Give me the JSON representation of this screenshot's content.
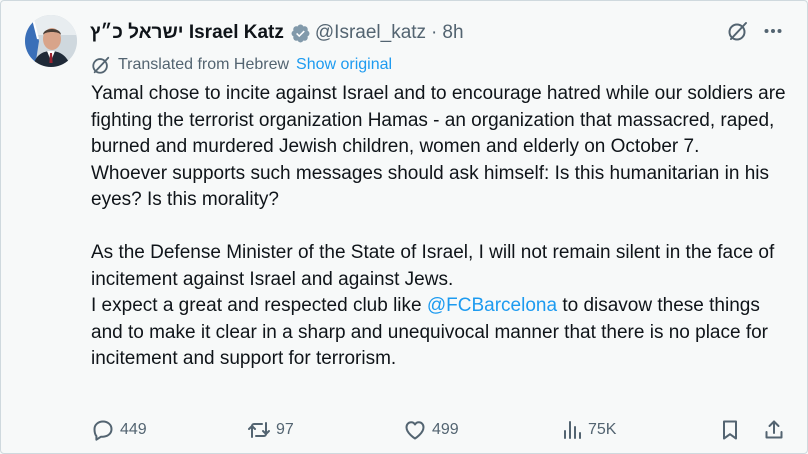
{
  "author": {
    "hebrew_name": "ישראל כ״ץ",
    "display_name": "Israel Katz",
    "handle": "@Israel_katz",
    "separator": "·",
    "time": "8h"
  },
  "translation": {
    "label": "Translated from Hebrew",
    "link": "Show original"
  },
  "body": {
    "line1": "Yamal chose to incite against Israel and to encourage hatred while our soldiers are fighting the terrorist organization Hamas - an organization that massacred, raped, burned and murdered Jewish children, women and elderly on October 7.",
    "line2": "Whoever supports such messages should ask himself: Is this humanitarian in his eyes? Is this morality?",
    "line3": "As the Defense Minister of the State of Israel, I will not remain silent in the face of incitement against Israel and against Jews.",
    "line4_pre": "I expect a great and respected club like ",
    "line4_mention": "@FCBarcelona",
    "line4_post": " to disavow these things and to make it clear in a sharp and unequivocal manner that there is no place for incitement and support for terrorism."
  },
  "actions": {
    "replies": "449",
    "reposts": "97",
    "likes": "499",
    "views": "75K"
  },
  "icons": [
    "verified-icon",
    "grok-icon",
    "more-icon",
    "translate-icon",
    "reply-icon",
    "repost-icon",
    "like-icon",
    "views-icon",
    "bookmark-icon",
    "share-icon"
  ],
  "colors": {
    "accent": "#1d9bf0",
    "text": "#0f1419",
    "secondary": "#536471",
    "background": "#f7f9f9"
  }
}
